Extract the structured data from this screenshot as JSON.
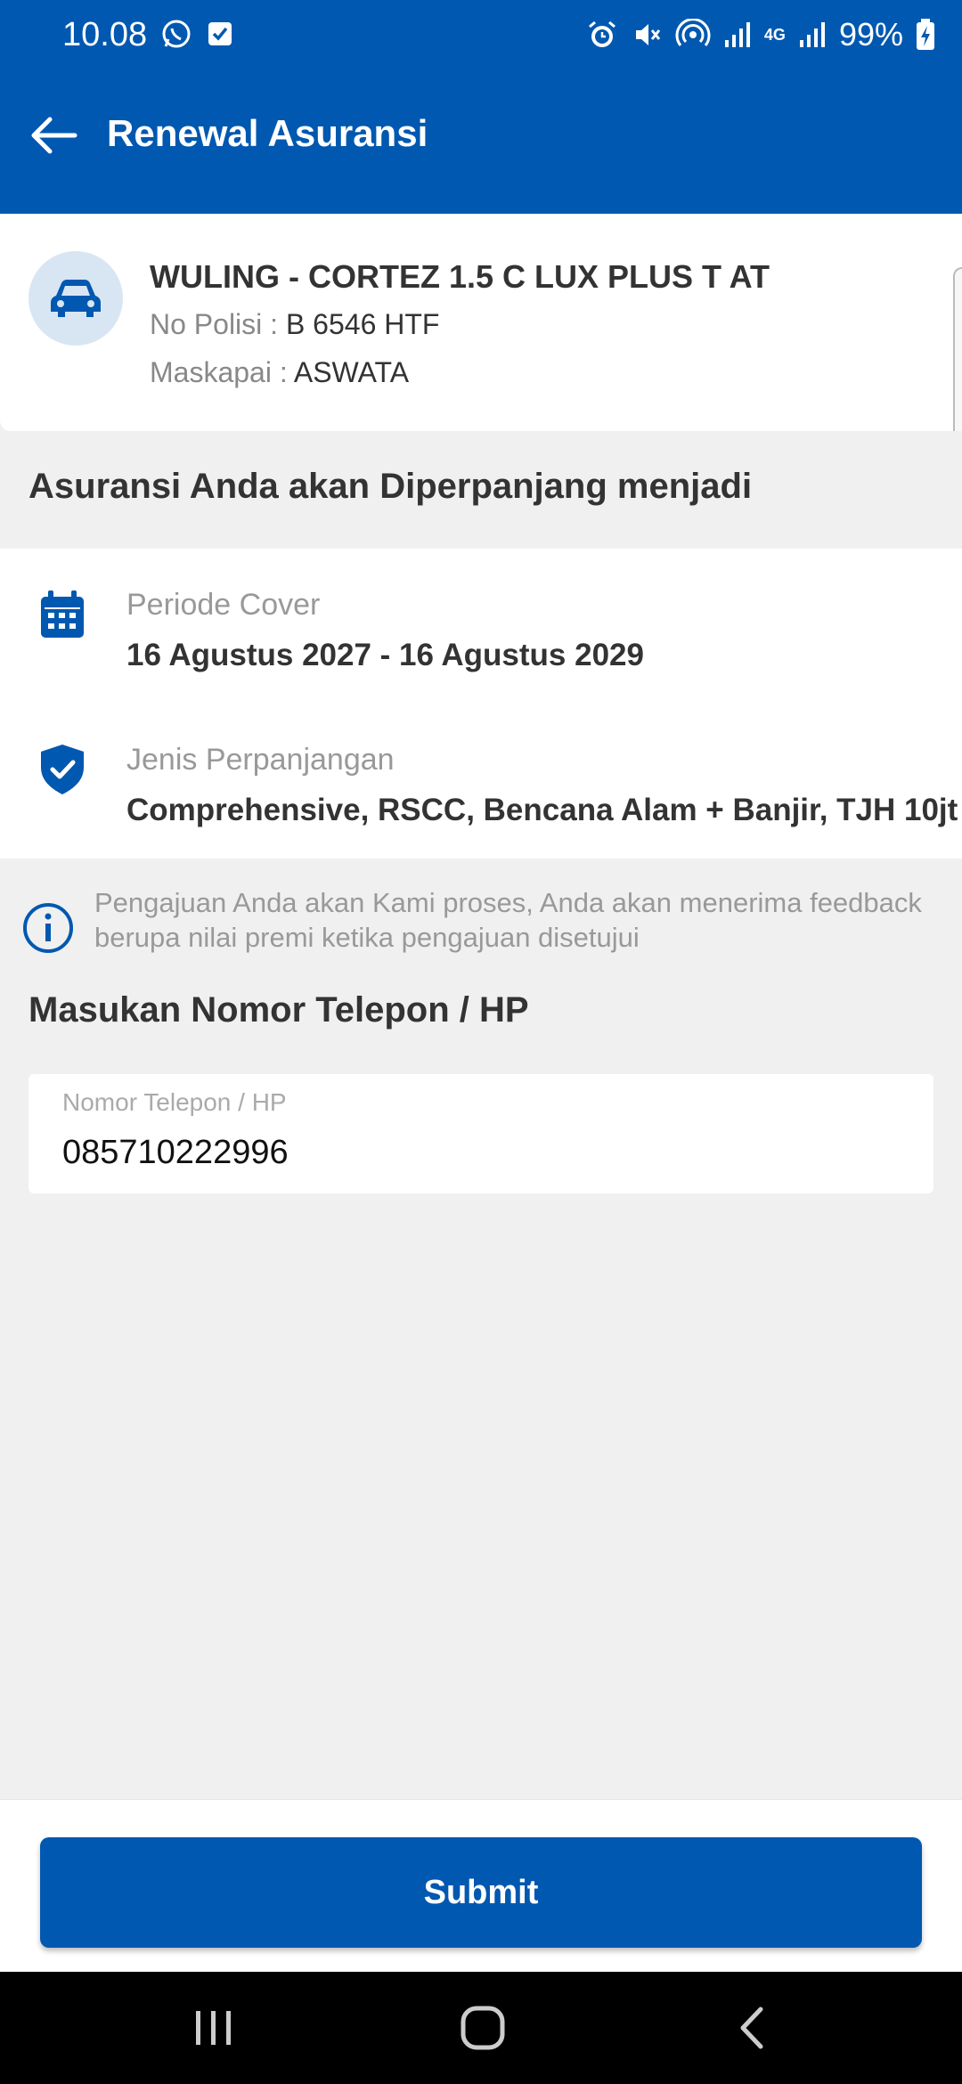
{
  "status_bar": {
    "time": "10.08",
    "battery": "99%",
    "network": "4G"
  },
  "header": {
    "title": "Renewal Asuransi"
  },
  "vehicle": {
    "name": "WULING - CORTEZ 1.5 C LUX PLUS T AT",
    "plate_label": "No Polisi : ",
    "plate_value": "B 6546 HTF",
    "insurer_label": "Maskapai : ",
    "insurer_value": "ASWATA"
  },
  "renewal_section": {
    "heading": "Asuransi Anda akan Diperpanjang menjadi",
    "period_label": "Periode Cover",
    "period_value": "16 Agustus 2027 - 16 Agustus 2029",
    "type_label": "Jenis Perpanjangan",
    "type_value": "Comprehensive, RSCC, Bencana Alam + Banjir, TJH 10jt"
  },
  "info_note": "Pengajuan Anda akan Kami proses, Anda akan menerima feedback berupa nilai premi ketika pengajuan disetujui",
  "phone_section": {
    "heading": "Masukan Nomor Telepon / HP",
    "field_label": "Nomor Telepon / HP",
    "field_value": "085710222996"
  },
  "actions": {
    "submit_label": "Submit"
  },
  "colors": {
    "primary": "#0158b0",
    "background": "#f0f0f0",
    "avatar_bg": "#d8e6f4"
  },
  "icons": {
    "back": "arrow-left-icon",
    "car": "car-icon",
    "calendar": "calendar-icon",
    "shield": "shield-check-icon",
    "info": "info-icon"
  }
}
